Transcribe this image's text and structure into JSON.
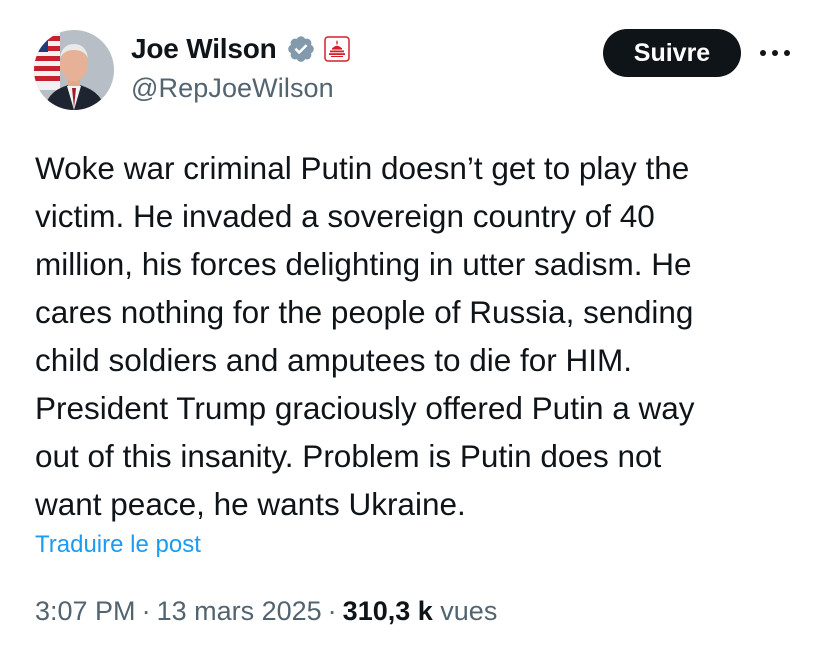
{
  "author": {
    "display_name": "Joe Wilson",
    "handle": "@RepJoeWilson",
    "verified_icon": "verified-badge-icon",
    "affiliation_icon": "us-congress-affiliation-icon"
  },
  "actions": {
    "follow_label": "Suivre",
    "more_icon": "more-options-icon"
  },
  "tweet": {
    "text": "Woke war criminal Putin doesn’t get to play the\nvictim. He invaded a sovereign country of 40\nmillion, his forces delighting in utter sadism. He\ncares nothing for the people of Russia, sending\nchild soldiers and amputees to die for HIM.\nPresident Trump graciously offered Putin a way\nout of this insanity. Problem is Putin does not\nwant peace, he wants Ukraine.",
    "translate_label": "Traduire le post"
  },
  "meta": {
    "time": "3:07 PM",
    "separator": "·",
    "date": "13 mars 2025",
    "views_count": "310,3 k",
    "views_label": "vues"
  },
  "colors": {
    "text": "#0f1419",
    "secondary": "#536471",
    "link": "#1d9bf0",
    "follow_bg": "#0f1419",
    "verified_badge": "#829aab",
    "affiliation_red": "#d0222a"
  }
}
